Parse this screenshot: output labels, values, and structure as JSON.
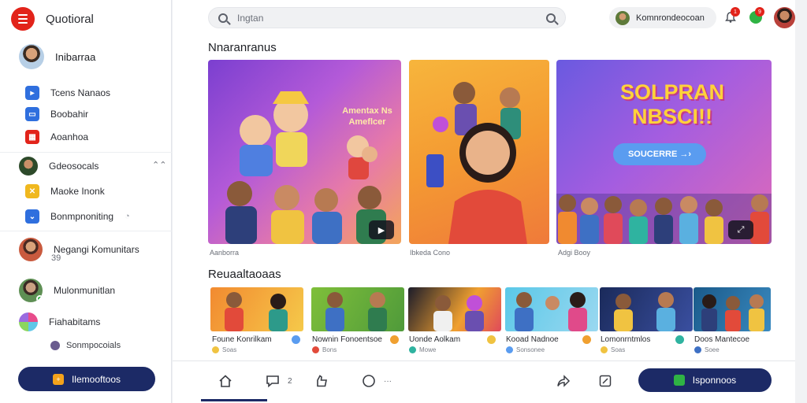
{
  "app": {
    "name": "Quotioral"
  },
  "user": {
    "name": "Inibarraa"
  },
  "nav": [
    {
      "label": "Tcens Nanaos",
      "icon": "profile-icon",
      "color": "#2f6fde"
    },
    {
      "label": "Boobahir",
      "icon": "chat-icon",
      "color": "#2f6fde"
    },
    {
      "label": "Aoanhoa",
      "icon": "calendar-icon",
      "color": "#e2231a"
    }
  ],
  "group_header": {
    "label": "Gdeosocals"
  },
  "nav2": [
    {
      "label": "Maoke Inonk",
      "icon": "close-icon",
      "color": "#f0b81e"
    },
    {
      "label": "Bonmpnoniting",
      "icon": "chevron-down-icon",
      "color": "#2f6fde"
    }
  ],
  "communities": [
    {
      "label": "Negangi Komunitars",
      "sub": "39"
    },
    {
      "label": "Mulonmunitlan"
    },
    {
      "label": "Fiahabitams"
    }
  ],
  "sub_item": {
    "label": "Sonmpocoials"
  },
  "side_cta": {
    "label": "Ilemooftoos"
  },
  "search": {
    "placeholder": "Ingtan"
  },
  "community_chip": {
    "label": "Komnrondeocoan"
  },
  "badges": {
    "bell": "1",
    "msg": "9"
  },
  "sections": {
    "featured": "Nnaranranus",
    "recent": "Reuaaltaoaas"
  },
  "featured_cards": [
    {
      "caption": "Aanborra",
      "banner": "Amentax Ns Ameflcer"
    },
    {
      "caption": "Ibkeda Cono"
    },
    {
      "caption": "Adgi Booy",
      "banner": "SOLPRAN NBSCI!!",
      "button": "SOUCERRE →›"
    }
  ],
  "thumbs": [
    {
      "title": "Foune Konrilkam",
      "meta": "Soas"
    },
    {
      "title": "Nownin Fonoentsoe",
      "meta": "Bons"
    },
    {
      "title": "Uonde Aolkam",
      "meta": "Mowe"
    },
    {
      "title": "Kooad Nadnoe",
      "meta": "Sonsonee"
    },
    {
      "title": "Lomonrntmlos",
      "meta": "Soas"
    },
    {
      "title": "Doos Mantecoe",
      "meta": "Soee"
    }
  ],
  "bottom": {
    "comment_count": "2",
    "circle_count": "···",
    "cta": "Isponnoos"
  },
  "colors": {
    "brand": "#e2231a",
    "accent": "#1c2a66",
    "online": "#2fb344"
  }
}
